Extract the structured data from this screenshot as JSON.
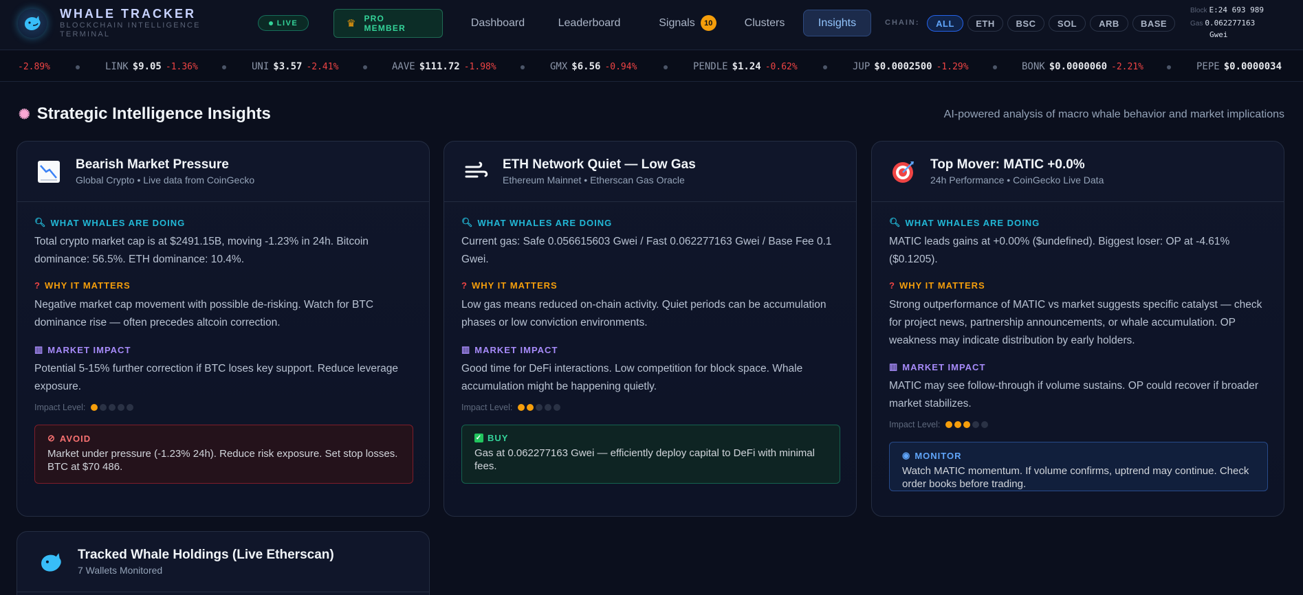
{
  "brand": {
    "title": "WHALE TRACKER",
    "subtitle_line1": "BLOCKCHAIN INTELLIGENCE",
    "subtitle_line2": "TERMINAL"
  },
  "live_label": "LIVE",
  "pro": {
    "line1": "PRO",
    "line2": "MEMBER"
  },
  "nav": [
    {
      "label": "Dashboard"
    },
    {
      "label": "Leaderboard"
    },
    {
      "label": "Signals",
      "badge": "10"
    },
    {
      "label": "Clusters"
    },
    {
      "label": "Insights",
      "active": true
    }
  ],
  "chain_label": "CHAIN:",
  "chains": [
    "ALL",
    "ETH",
    "BSC",
    "SOL",
    "ARB",
    "BASE"
  ],
  "block": {
    "block_key": "Block",
    "block_val": "E:24 693 989",
    "gas_key": "Gas",
    "gas_val": "0.062277163",
    "gas_unit": "Gwei"
  },
  "ticker": [
    {
      "sym": "",
      "price": "",
      "change": "-2.89%"
    },
    {
      "sym": "LINK",
      "price": "$9.05",
      "change": "-1.36%"
    },
    {
      "sym": "UNI",
      "price": "$3.57",
      "change": "-2.41%"
    },
    {
      "sym": "AAVE",
      "price": "$111.72",
      "change": "-1.98%"
    },
    {
      "sym": "GMX",
      "price": "$6.56",
      "change": "-0.94%"
    },
    {
      "sym": "PENDLE",
      "price": "$1.24",
      "change": "-0.62%"
    },
    {
      "sym": "JUP",
      "price": "$0.0002500",
      "change": "-1.29%"
    },
    {
      "sym": "BONK",
      "price": "$0.0000060",
      "change": "-2.21%"
    },
    {
      "sym": "PEPE",
      "price": "$0.0000034",
      "change": ""
    }
  ],
  "section": {
    "title": "Strategic Intelligence Insights",
    "subtitle": "AI-powered analysis of macro whale behavior and market implications"
  },
  "labels": {
    "whales": "WHAT WHALES ARE DOING",
    "why": "WHY IT MATTERS",
    "impact": "MARKET IMPACT",
    "impact_level": "Impact Level:"
  },
  "cards": [
    {
      "title": "Bearish Market Pressure",
      "subtitle": "Global Crypto • Live data from CoinGecko",
      "whales": "Total crypto market cap is at $2491.15B, moving -1.23% in 24h. Bitcoin dominance: 56.5%. ETH dominance: 10.4%.",
      "why": "Negative market cap movement with possible de-risking. Watch for BTC dominance rise — often precedes altcoin correction.",
      "impact": "Potential 5-15% further correction if BTC loses key support. Reduce leverage exposure.",
      "impact_level": 1,
      "rec_title": "AVOID",
      "rec_body": "Market under pressure (-1.23% 24h). Reduce risk exposure. Set stop losses. BTC at $70 486."
    },
    {
      "title": "ETH Network Quiet — Low Gas",
      "subtitle": "Ethereum Mainnet • Etherscan Gas Oracle",
      "whales": "Current gas: Safe 0.056615603 Gwei / Fast 0.062277163 Gwei / Base Fee 0.1 Gwei.",
      "why": "Low gas means reduced on-chain activity. Quiet periods can be accumulation phases or low conviction environments.",
      "impact": "Good time for DeFi interactions. Low competition for block space. Whale accumulation might be happening quietly.",
      "impact_level": 2,
      "rec_title": "BUY",
      "rec_body": "Gas at 0.062277163 Gwei — efficiently deploy capital to DeFi with minimal fees."
    },
    {
      "title": "Top Mover: MATIC +0.0%",
      "subtitle": "24h Performance • CoinGecko Live Data",
      "whales": "MATIC leads gains at +0.00% ($undefined). Biggest loser: OP at -4.61% ($0.1205).",
      "why": "Strong outperformance of MATIC vs market suggests specific catalyst — check for project news, partnership announcements, or whale accumulation. OP weakness may indicate distribution by early holders.",
      "impact": "MATIC may see follow-through if volume sustains. OP could recover if broader market stabilizes.",
      "impact_level": 3,
      "rec_title": "MONITOR",
      "rec_body": "Watch MATIC momentum. If volume confirms, uptrend may continue. Check order books before trading."
    }
  ],
  "holdings": {
    "title": "Tracked Whale Holdings (Live Etherscan)",
    "subtitle": "7 Wallets Monitored"
  },
  "colors": {
    "accent": "#60a5fa",
    "positive": "#34d399",
    "negative": "#ef4444",
    "warning": "#f59e0b"
  }
}
